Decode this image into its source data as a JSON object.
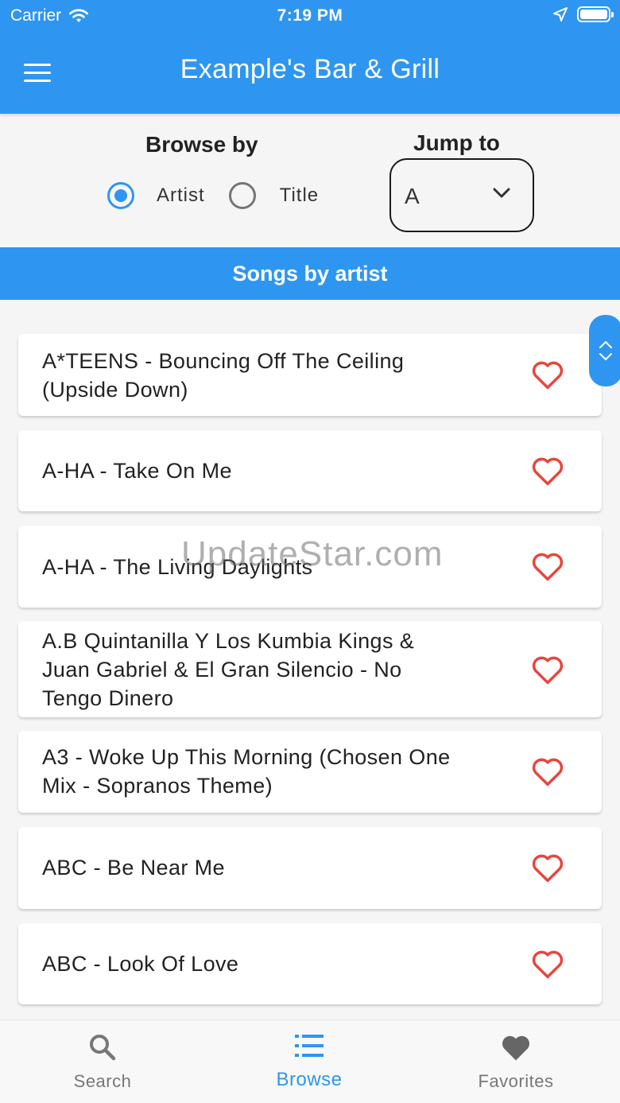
{
  "status_bar": {
    "carrier": "Carrier",
    "time": "7:19 PM"
  },
  "app_bar": {
    "title": "Example's Bar & Grill"
  },
  "browse": {
    "label": "Browse by",
    "options": [
      "Artist",
      "Title"
    ],
    "selected": "Artist"
  },
  "jump": {
    "label": "Jump to",
    "value": "A"
  },
  "section_header": "Songs by artist",
  "songs": [
    {
      "line1": "A*TEENS - Bouncing Off The Ceiling",
      "line2": "(Upside Down)",
      "line3": ""
    },
    {
      "line1": "A-HA - Take On Me",
      "line2": "",
      "line3": ""
    },
    {
      "line1": "A-HA - The Living Daylights",
      "line2": "",
      "line3": ""
    },
    {
      "line1": "A.B Quintanilla Y Los Kumbia Kings &",
      "line2": "Juan Gabriel & El Gran Silencio - No",
      "line3": "Tengo Dinero"
    },
    {
      "line1": "A3 - Woke Up This Morning (Chosen One",
      "line2": "Mix - Sopranos Theme)",
      "line3": ""
    },
    {
      "line1": "ABC - Be Near Me",
      "line2": "",
      "line3": ""
    },
    {
      "line1": "ABC - Look Of Love",
      "line2": "",
      "line3": ""
    }
  ],
  "watermark": "UpdateStar.com",
  "bottom_nav": {
    "items": [
      {
        "label": "Search",
        "icon": "search-icon"
      },
      {
        "label": "Browse",
        "icon": "list-icon"
      },
      {
        "label": "Favorites",
        "icon": "heart-icon"
      }
    ],
    "active": "Browse"
  },
  "colors": {
    "primary": "#2e96f0",
    "heart": "#e8453c"
  }
}
